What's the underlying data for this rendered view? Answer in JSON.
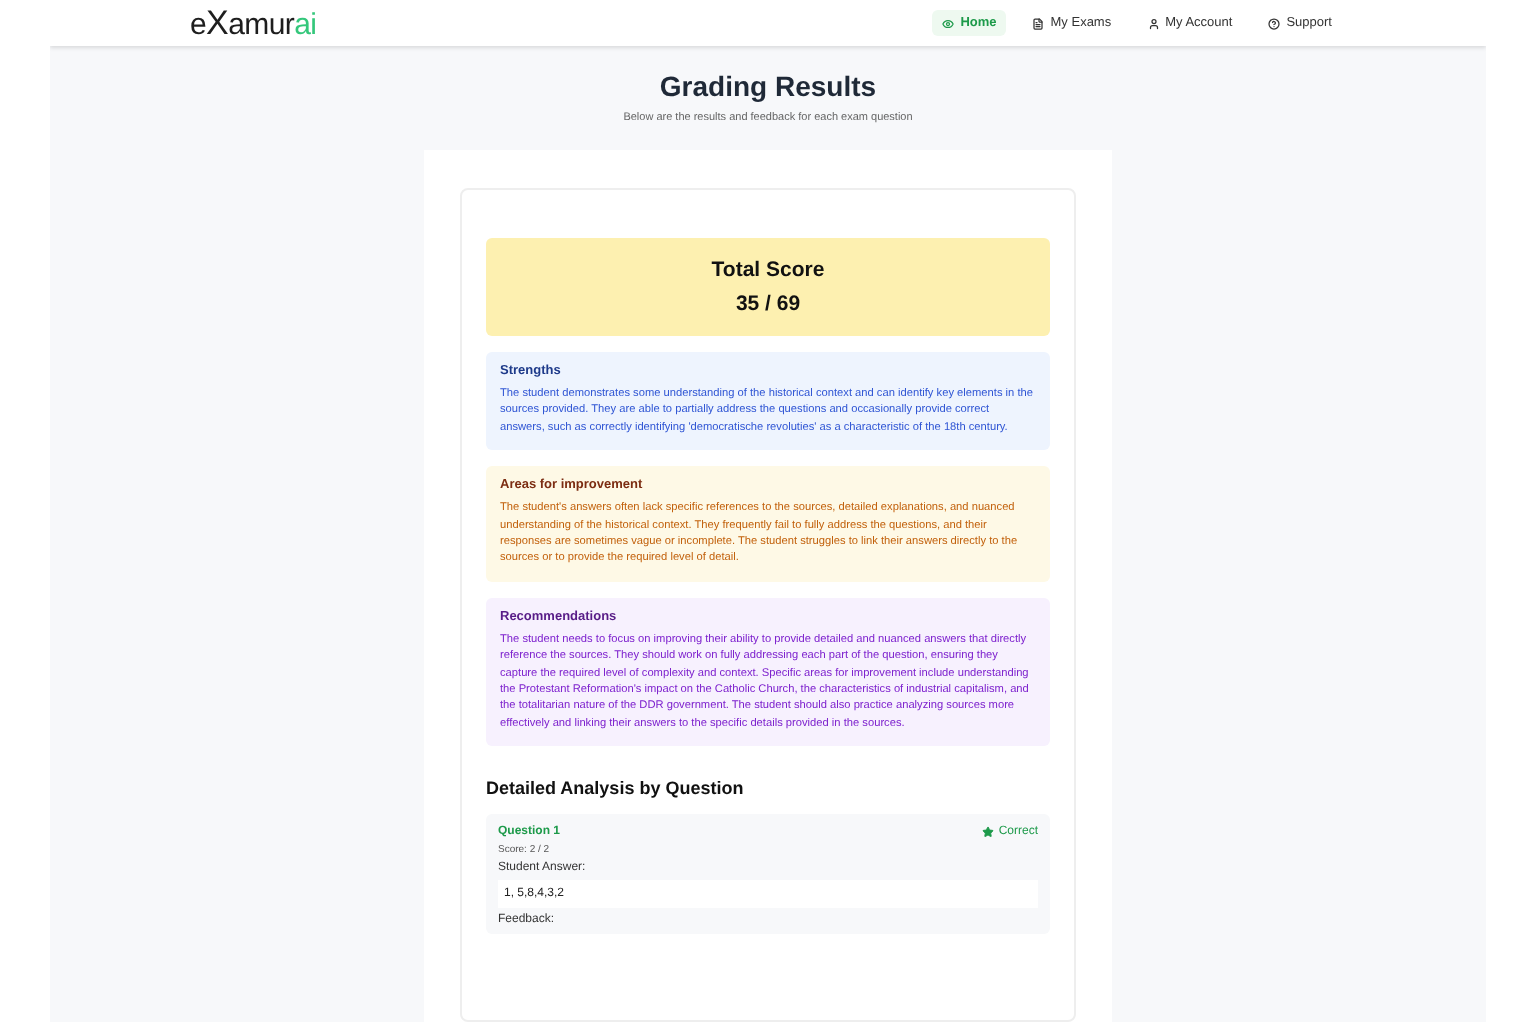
{
  "logo": {
    "parts": [
      {
        "text": "e",
        "kind": "plain"
      },
      {
        "text": "X",
        "kind": "mark"
      },
      {
        "text": "amur",
        "kind": "plain"
      },
      {
        "text": "ai",
        "kind": "accent"
      }
    ]
  },
  "nav": [
    {
      "label": "Home",
      "kind": "eye",
      "selected": true
    },
    {
      "label": "My Exams",
      "kind": "file",
      "selected": false
    },
    {
      "label": "My Account",
      "kind": "user",
      "selected": false
    },
    {
      "label": "Support",
      "kind": "help",
      "selected": false
    }
  ],
  "page": {
    "title": "Grading Results",
    "subtitle": "Below are the results and feedback for each exam question"
  },
  "score": {
    "label": "Total Score",
    "value": "35 / 69"
  },
  "feedback": [
    {
      "kind": "strengths",
      "title": "Strengths",
      "text": "The student demonstrates some understanding of the historical context and can identify key elements in the sources provided. They are able to partially address the questions and occasionally provide correct answers, such as correctly identifying 'democratische revoluties' as a characteristic of the 18th century."
    },
    {
      "kind": "improvement",
      "title": "Areas for improvement",
      "text": "The student's answers often lack specific references to the sources, detailed explanations, and nuanced understanding of the historical context. They frequently fail to fully address the questions, and their responses are sometimes vague or incomplete. The student struggles to link their answers directly to the sources or to provide the required level of detail."
    },
    {
      "kind": "recommendations",
      "title": "Recommendations",
      "text": "The student needs to focus on improving their ability to provide detailed and nuanced answers that directly reference the sources. They should work on fully addressing each part of the question, ensuring they capture the required level of complexity and context. Specific areas for improvement include understanding the Protestant Reformation's impact on the Catholic Church, the characteristics of industrial capitalism, and the totalitarian nature of the DDR government. The student should also practice analyzing sources more effectively and linking their answers to the specific details provided in the sources."
    }
  ],
  "analysis": {
    "heading": "Detailed Analysis by Question",
    "questions": [
      {
        "title": "Question 1",
        "status": "Correct",
        "kind": "correct",
        "score": "Score: 2 / 2",
        "answer_label": "Student Answer:",
        "answer": "1, 5,8,4,3,2",
        "feedback_label": "Feedback:"
      }
    ]
  }
}
